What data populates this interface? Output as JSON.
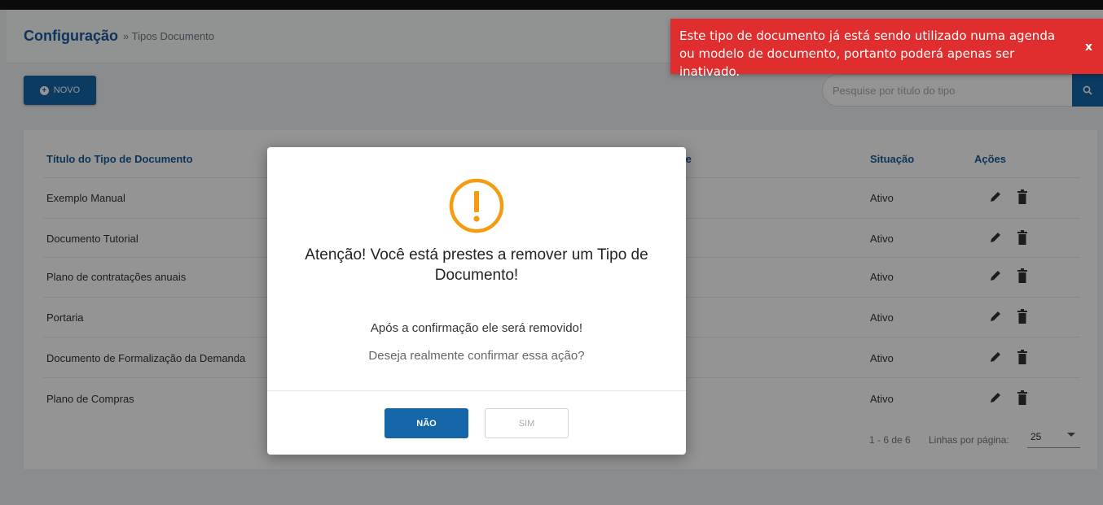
{
  "header": {
    "title": "Configuração",
    "breadcrumb": "» Tipos Documento"
  },
  "toolbar": {
    "new_label": "NOVO",
    "search_placeholder": "Pesquise por título do tipo"
  },
  "table": {
    "columns": {
      "title": "Título do Tipo de Documento",
      "hidden_partial": "le",
      "status": "Situação",
      "actions": "Ações"
    },
    "rows": [
      {
        "title": "Exemplo Manual",
        "status": "Ativo"
      },
      {
        "title": "Documento Tutorial",
        "status": "Ativo"
      },
      {
        "title": "Plano de contratações anuais",
        "status": "Ativo"
      },
      {
        "title": "Portaria",
        "status": "Ativo"
      },
      {
        "title": "Documento de Formalização da Demanda",
        "status": "Ativo"
      },
      {
        "title": "Plano de Compras",
        "status": "Ativo"
      }
    ],
    "pagination": {
      "range": "1 - 6 de 6",
      "rows_label": "Linhas por página:",
      "rows_value": "25"
    }
  },
  "modal": {
    "icon": "warning-circle-icon",
    "title": "Atenção! Você está prestes a remover um Tipo de Documento!",
    "line1": "Após a confirmação ele será removido!",
    "line2": "Deseja realmente confirmar essa ação?",
    "no_label": "NÃO",
    "yes_label": "SIM"
  },
  "toast": {
    "message": "Este tipo de documento já está sendo utilizado numa agenda ou modelo de documento, portanto poderá apenas ser inativado.",
    "close_label": "x"
  },
  "colors": {
    "primary": "#1466a8",
    "accent_warning": "#f39c12",
    "toast_error": "#e02e2e"
  }
}
